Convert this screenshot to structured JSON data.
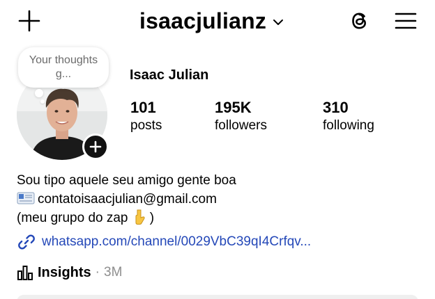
{
  "header": {
    "username": "isaacjulianz",
    "create_icon": "plus-icon",
    "username_dropdown_icon": "chevron-down-icon",
    "threads_icon": "threads-icon",
    "menu_icon": "hamburger-menu-icon"
  },
  "note": {
    "text": "Your thoughts g..."
  },
  "profile": {
    "display_name": "Isaac Julian",
    "add_story_icon": "plus-icon"
  },
  "stats": {
    "posts": {
      "value": "101",
      "label": "posts"
    },
    "followers": {
      "value": "195K",
      "label": "followers"
    },
    "following": {
      "value": "310",
      "label": "following"
    }
  },
  "bio": {
    "line1": "Sou tipo aquele seu amigo gente boa",
    "email": "contatoisaacjulian@gmail.com",
    "email_icon": "envelope-icon",
    "line3_text": "(meu grupo do zap",
    "line3_end": ")",
    "pointing_icon": "pointing-down-icon"
  },
  "link": {
    "icon": "link-icon",
    "text": "whatsapp.com/channel/0029VbC39qI4Crfqv..."
  },
  "insights": {
    "icon": "bar-chart-icon",
    "label": "Insights",
    "separator": "·",
    "meta": "3M"
  },
  "colors": {
    "link": "#2448b8",
    "muted": "#8e8e8e",
    "text": "#000000",
    "background": "#ffffff"
  }
}
